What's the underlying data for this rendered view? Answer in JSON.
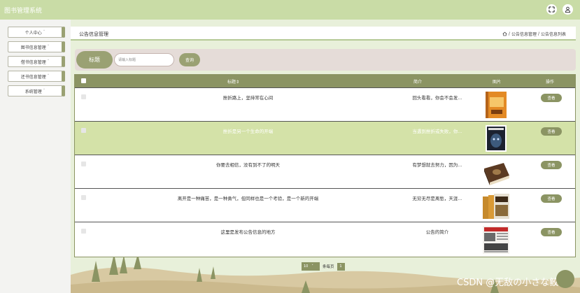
{
  "app": {
    "title": "图书管理系统"
  },
  "sidebar": {
    "items": [
      {
        "label": "个人中心"
      },
      {
        "label": "图书信息管理"
      },
      {
        "label": "借书信息管理"
      },
      {
        "label": "还书信息管理"
      },
      {
        "label": "系统管理"
      }
    ],
    "caret": "˅"
  },
  "header": {
    "title": "公告信息管理",
    "breadcrumb": [
      "公告信息管理",
      "公告信息列表"
    ],
    "separator": "/"
  },
  "search": {
    "label": "标题",
    "placeholder": "请输入标题",
    "button": "查询"
  },
  "table": {
    "columns": [
      "标题",
      "简介",
      "图片",
      "操作"
    ],
    "sort_mark": "⇕",
    "action_label": "查看",
    "rows": [
      {
        "title": "挫折路上，坚持常在心间",
        "intro": "回头看看，你会不会发...",
        "selected": false,
        "image": "book-orange"
      },
      {
        "title": "挫折是另一个生命的开端",
        "intro": "当遇到挫折或失败，你...",
        "selected": true,
        "image": "book-dark-face"
      },
      {
        "title": "你要去相信，没有到不了的明天",
        "intro": "有梦想就去努力，因为...",
        "selected": false,
        "image": "book-brown-old"
      },
      {
        "title": "离开是一种痛苦，是一种勇气，但同样也是一个考验，是一个新的开端",
        "intro": "无穷无尽是离愁，天涯...",
        "selected": false,
        "image": "book-set"
      },
      {
        "title": "这里是发布公告信息的地方",
        "intro": "公告的简介",
        "selected": false,
        "image": "newspaper"
      }
    ]
  },
  "pager": {
    "page_size": "10",
    "per_page_label": "条每页",
    "current": "1"
  },
  "watermark": "CSDN @无敌の小さな鲛",
  "colors": {
    "accent": "#8b9463",
    "topbar": "#c9dca6",
    "selected_row": "#d4e2a8"
  }
}
